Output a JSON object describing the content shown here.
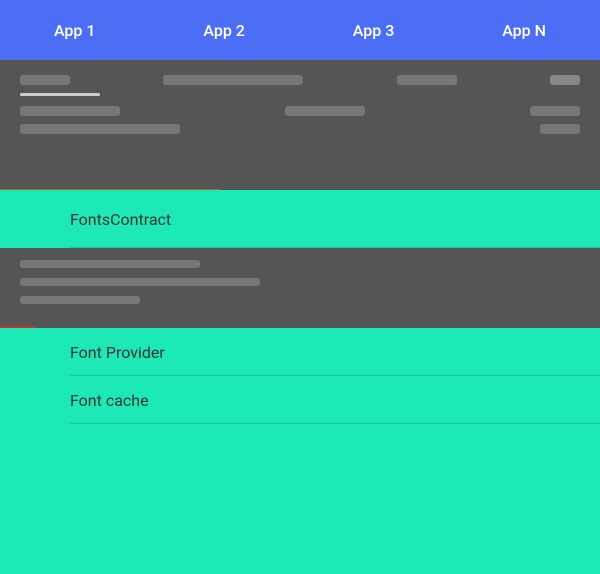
{
  "appBar": {
    "tabs": [
      {
        "label": "App 1"
      },
      {
        "label": "App 2"
      },
      {
        "label": "App 3"
      },
      {
        "label": "App N"
      }
    ]
  },
  "sections": {
    "fontsContract": {
      "label": "FontsContract"
    },
    "fontProvider": {
      "label": "Font Provider"
    },
    "fontCache": {
      "label": "Font cache"
    }
  },
  "colors": {
    "appBar": "#4c6ef5",
    "darkSection": "#555555",
    "tealSection": "#1de9b6",
    "tabText": "#ffffff"
  }
}
